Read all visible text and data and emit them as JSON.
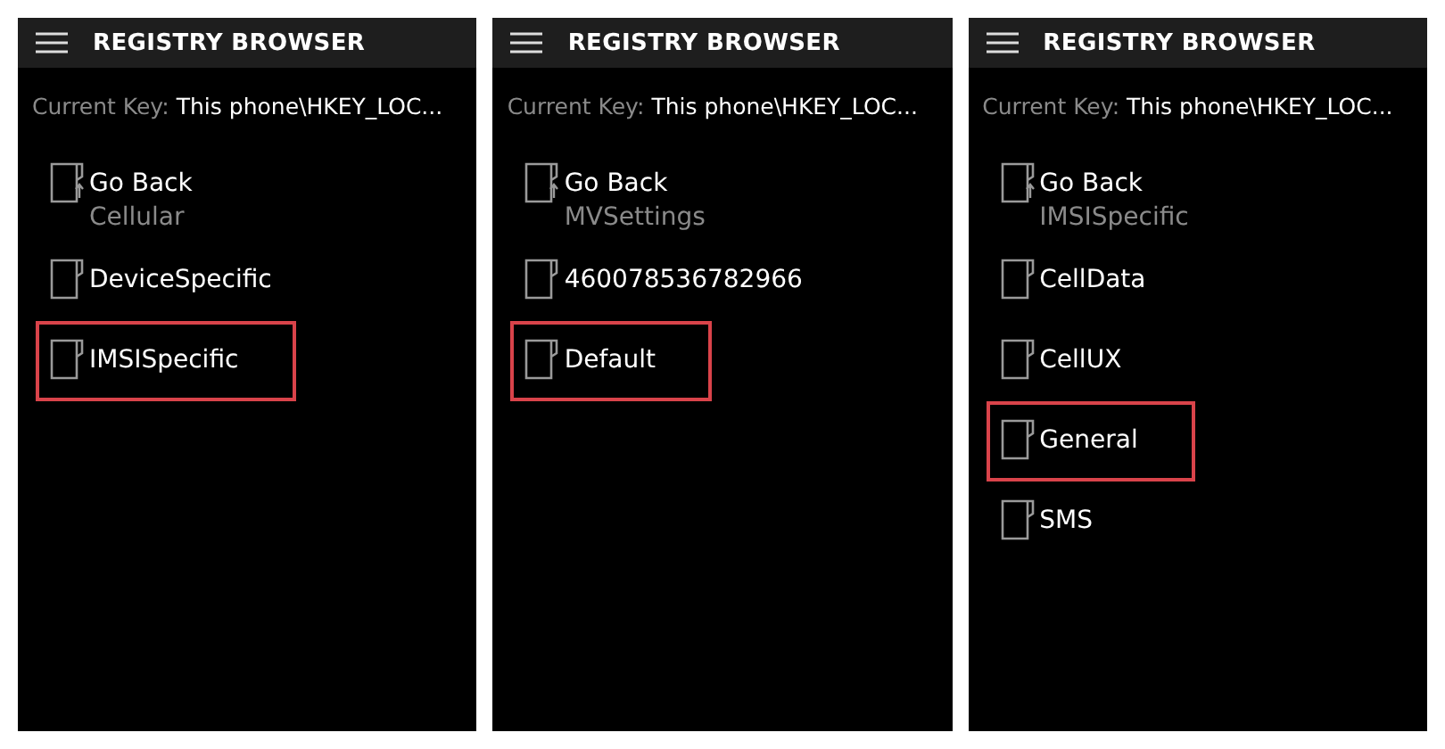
{
  "screens": [
    {
      "title": "REGISTRY BROWSER",
      "current_key_label": "Current Key:",
      "current_key_value": "This phone\\HKEY_LOC...",
      "items": [
        {
          "kind": "back",
          "label": "Go Back",
          "parent": "Cellular",
          "highlighted": false
        },
        {
          "kind": "key",
          "label": "DeviceSpecific",
          "highlighted": false
        },
        {
          "kind": "key",
          "label": "IMSISpecific",
          "highlighted": true
        }
      ]
    },
    {
      "title": "REGISTRY BROWSER",
      "current_key_label": "Current Key:",
      "current_key_value": "This phone\\HKEY_LOC...",
      "items": [
        {
          "kind": "back",
          "label": "Go Back",
          "parent": "MVSettings",
          "highlighted": false
        },
        {
          "kind": "key",
          "label": "460078536782966",
          "highlighted": false
        },
        {
          "kind": "key",
          "label": "Default",
          "highlighted": true
        }
      ]
    },
    {
      "title": "REGISTRY BROWSER",
      "current_key_label": "Current Key:",
      "current_key_value": "This phone\\HKEY_LOC...",
      "items": [
        {
          "kind": "back",
          "label": "Go Back",
          "parent": "IMSISpecific",
          "highlighted": false
        },
        {
          "kind": "key",
          "label": "CellData",
          "highlighted": false
        },
        {
          "kind": "key",
          "label": "CellUX",
          "highlighted": false
        },
        {
          "kind": "key",
          "label": "General",
          "highlighted": true
        },
        {
          "kind": "key",
          "label": "SMS",
          "highlighted": false
        }
      ]
    }
  ]
}
